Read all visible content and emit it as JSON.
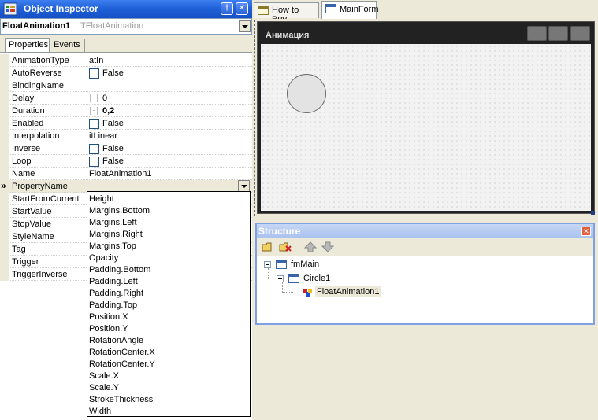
{
  "object_inspector": {
    "title": "Object Inspector",
    "pin_glyph": "†",
    "close_glyph": "✕",
    "selected_object": "FloatAnimation1",
    "selected_class": "TFloatAnimation",
    "tabs": [
      "Properties",
      "Events"
    ],
    "active_tab": "Properties",
    "properties": [
      {
        "name": "AnimationType",
        "value": "atIn",
        "kind": "text"
      },
      {
        "name": "AutoReverse",
        "value": "False",
        "kind": "check"
      },
      {
        "name": "BindingName",
        "value": "",
        "kind": "text"
      },
      {
        "name": "Delay",
        "value": "0",
        "kind": "int"
      },
      {
        "name": "Duration",
        "value": "0,2",
        "kind": "int-bold"
      },
      {
        "name": "Enabled",
        "value": "False",
        "kind": "check"
      },
      {
        "name": "Interpolation",
        "value": "itLinear",
        "kind": "text"
      },
      {
        "name": "Inverse",
        "value": "False",
        "kind": "check"
      },
      {
        "name": "Loop",
        "value": "False",
        "kind": "check"
      },
      {
        "name": "Name",
        "value": "FloatAnimation1",
        "kind": "text"
      },
      {
        "name": "PropertyName",
        "value": "",
        "kind": "selected"
      },
      {
        "name": "StartFromCurrent",
        "value": "",
        "kind": "text"
      },
      {
        "name": "StartValue",
        "value": "",
        "kind": "text"
      },
      {
        "name": "StopValue",
        "value": "",
        "kind": "text"
      },
      {
        "name": "StyleName",
        "value": "",
        "kind": "text"
      },
      {
        "name": "Tag",
        "value": "",
        "kind": "text"
      },
      {
        "name": "Trigger",
        "value": "",
        "kind": "text"
      },
      {
        "name": "TriggerInverse",
        "value": "",
        "kind": "text"
      }
    ],
    "selected_arrow": "»",
    "property_name_options": [
      "Height",
      "Margins.Bottom",
      "Margins.Left",
      "Margins.Right",
      "Margins.Top",
      "Opacity",
      "Padding.Bottom",
      "Padding.Left",
      "Padding.Right",
      "Padding.Top",
      "Position.X",
      "Position.Y",
      "RotationAngle",
      "RotationCenter.X",
      "RotationCenter.Y",
      "Scale.X",
      "Scale.Y",
      "StrokeThickness",
      "Width"
    ]
  },
  "document_tabs": [
    {
      "label": "How to Buy",
      "active": false
    },
    {
      "label": "MainForm",
      "active": true
    }
  ],
  "form": {
    "caption": "Анимация"
  },
  "structure": {
    "title": "Structure",
    "close_glyph": "✕",
    "toolbar": [
      "new-folder-icon",
      "delete-icon",
      "move-up-icon",
      "move-down-icon"
    ],
    "tree": [
      {
        "label": "fmMain",
        "level": 0
      },
      {
        "label": "Circle1",
        "level": 1
      },
      {
        "label": "FloatAnimation1",
        "level": 2,
        "selected": true
      }
    ]
  },
  "colors": {
    "title_bar": "#1e5fd6",
    "form_background": "#222222",
    "structure_title": "#a9c1ee"
  }
}
